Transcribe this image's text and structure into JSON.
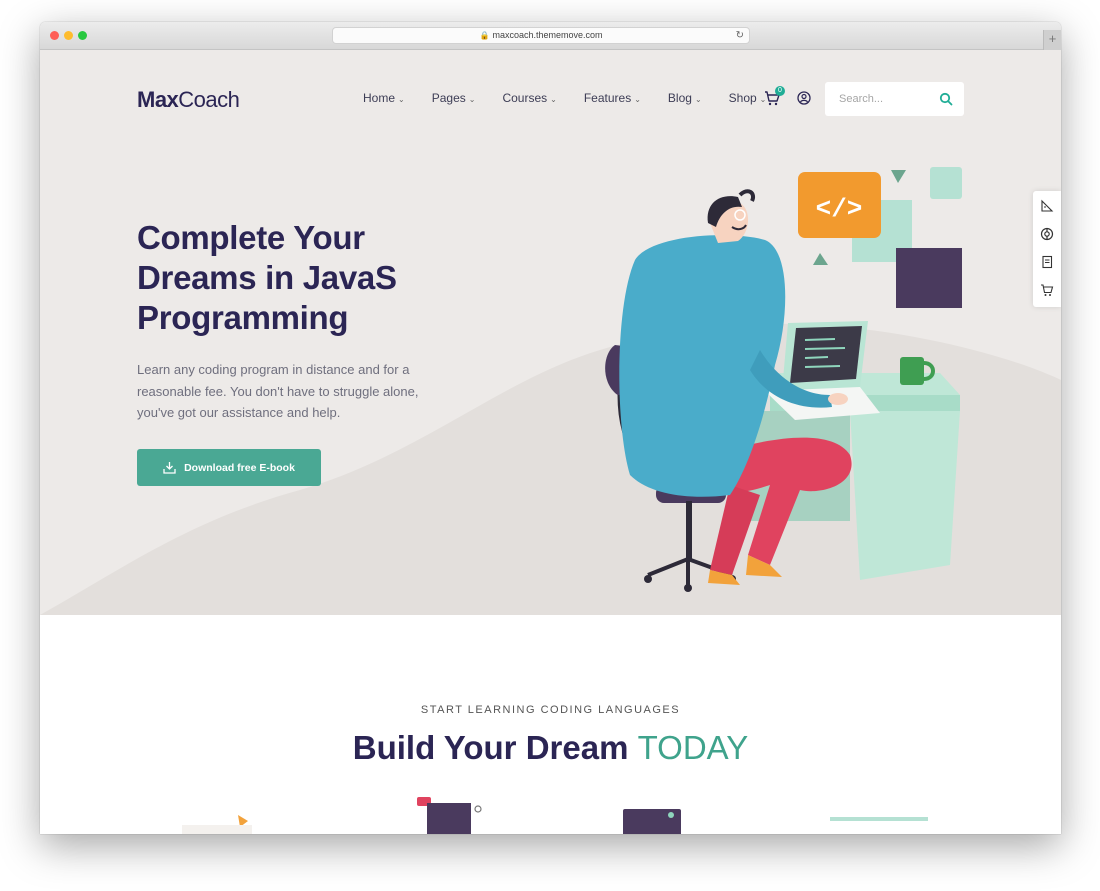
{
  "browser": {
    "url": "maxcoach.thememove.com"
  },
  "header": {
    "logo_bold": "Max",
    "logo_rest": "Coach",
    "nav": [
      {
        "label": "Home"
      },
      {
        "label": "Pages"
      },
      {
        "label": "Courses"
      },
      {
        "label": "Features"
      },
      {
        "label": "Blog"
      },
      {
        "label": "Shop"
      }
    ],
    "cart_count": "0",
    "search_placeholder": "Search..."
  },
  "hero": {
    "title_line1": "Complete Your",
    "title_line2": "Dreams in JavaS",
    "title_line3": "Programming",
    "description": "Learn any coding program in distance and for a reasonable fee. You don't have to struggle alone, you've got our assistance and help.",
    "button_label": "Download free E-book",
    "code_tag": "</>"
  },
  "section2": {
    "eyebrow": "START LEARNING CODING LANGUAGES",
    "title_main": "Build Your Dream ",
    "title_accent": "TODAY"
  },
  "colors": {
    "brand_navy": "#2b2554",
    "accent_green": "#4aa894",
    "hero_bg": "#edeae8"
  },
  "icons": [
    "lock-icon",
    "reload-icon",
    "chevron-down-icon",
    "cart-icon",
    "user-icon",
    "search-icon",
    "download-icon",
    "ruler-icon",
    "support-icon",
    "book-icon",
    "cart-icon"
  ]
}
